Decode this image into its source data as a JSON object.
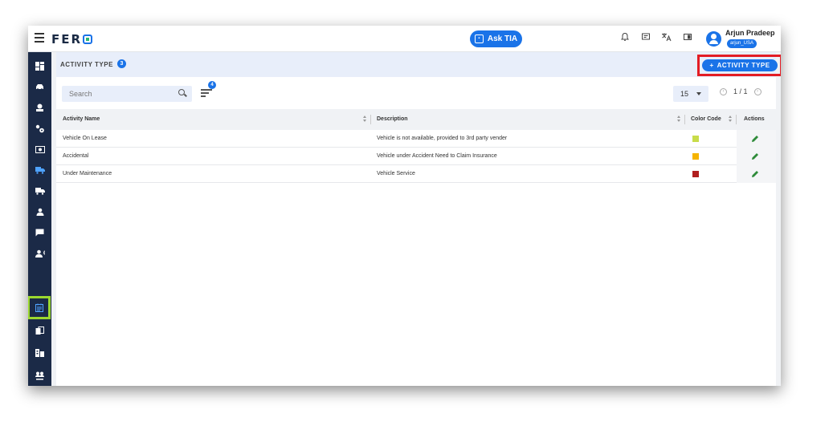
{
  "app": {
    "logo": "FER",
    "ask_button": "Ask TIA"
  },
  "user": {
    "name": "Arjun Pradeep",
    "tag": "arjun_USA"
  },
  "page": {
    "title": "ACTIVITY TYPE",
    "count": "3",
    "add_button": "ACTIVITY TYPE"
  },
  "search": {
    "placeholder": "Search"
  },
  "filter": {
    "badge": "4"
  },
  "pagination": {
    "page_size": "15",
    "page_info": "1 / 1"
  },
  "table": {
    "columns": [
      "Activity Name",
      "Description",
      "Color Code",
      "Actions"
    ],
    "rows": [
      {
        "name": "Vehicle On Lease",
        "description": "Vehicle is not available, provided to 3rd party vender",
        "color": "#c8dc4a"
      },
      {
        "name": "Accidental",
        "description": "Vehicle under Accident Need to Claim Insurance",
        "color": "#f5b400"
      },
      {
        "name": "Under Maintenance",
        "description": "Vehicle Service",
        "color": "#b01e1e"
      }
    ]
  },
  "icons": {
    "top": [
      "bell-icon",
      "chat-icon",
      "translate-icon",
      "panel-icon"
    ],
    "sidebar": [
      "dashboard-icon",
      "vehicle-settings-icon",
      "fleet-icon",
      "gear-group-icon",
      "money-icon",
      "truck-route-icon",
      "truck-icon",
      "person-icon",
      "message-icon",
      "driver-icon",
      "activity-type-icon",
      "document-icon",
      "building-icon",
      "group-icon",
      "report-icon"
    ]
  },
  "colors": {
    "primary": "#1a73e8",
    "sidebar": "#1b2a47",
    "highlight": "#9bd82f",
    "alert_frame": "#e31c24",
    "edit": "#2e8b3a"
  }
}
